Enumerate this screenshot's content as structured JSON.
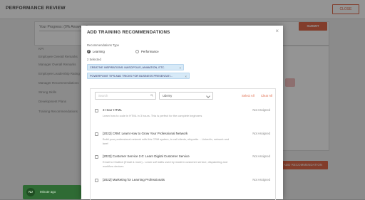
{
  "background": {
    "title": "PERFORMANCE REVIEW",
    "close_label": "CLOSE",
    "progress_label": "Your Progress: (0% Answered)",
    "submit_label": "SUBMIT",
    "side_items": [
      "KPI",
      "Employee Overall Remarks",
      "Manager Overall Remarks",
      "Employee Leadership Rating",
      "Manager Recommendations",
      "Strong Skills",
      "Development Plans",
      "Training Recommendations"
    ],
    "recommend_button": "ADD RECOMMENDATION"
  },
  "toast": {
    "initials": "NJ",
    "text": "Minute ago"
  },
  "modal": {
    "title": "ADD TRAINING RECOMMENDATIONS",
    "close_icon": "close-icon",
    "type_label": "Recommendations Type",
    "options": [
      {
        "label": "Learning",
        "selected": true
      },
      {
        "label": "Performance",
        "selected": false
      }
    ],
    "selected_count": "2 Selected",
    "chips": [
      "CREATIVE INSPIRATIONS: MASCIPOLIS, ANIMATION, ETC.",
      "POWERPOINT TIPS AND TRICKS FOR BUSINESS PRESENTATI..."
    ],
    "search_placeholder": "Search",
    "filter_value": "Udemy",
    "select_all": "Select All",
    "clear_all": "Clear All",
    "items": [
      {
        "title": "3 Hour HTML",
        "desc": "Learn how to code in HTML in 3 hours. This is perfect for the complete beginners",
        "status": "Not Assigned"
      },
      {
        "title": "[2022] CRM: Learn How to Grow Your Professional Network",
        "desc": "Build your professional network with this CRM system, to call clients, etiquette… LinkedIn, network and beef",
        "status": "Not Assigned"
      },
      {
        "title": "[2022] Customer Service 2.0: Learn Digital Customer Service",
        "desc": "Email to Chatbot (Email & more) - Learn soft skills used by modern customer service, dispatching and workflow devices",
        "status": "Not Assigned"
      },
      {
        "title": "[2022] Marketing for Learning Professionals",
        "desc": "",
        "status": "Not Assigned"
      }
    ]
  }
}
